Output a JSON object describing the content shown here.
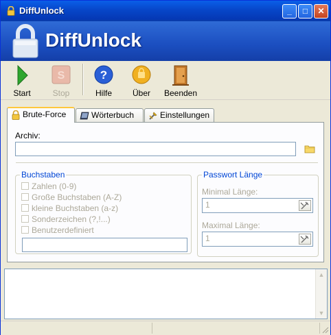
{
  "window": {
    "title": "DiffUnlock",
    "minimize": "_",
    "maximize": "□",
    "close": "✕"
  },
  "banner": {
    "app_name": "DiffUnlock",
    "lock_color": "#dfe8f4",
    "accent": "#1b4ec0"
  },
  "toolbar": {
    "start": "Start",
    "stop": "Stop",
    "help": "Hilfe",
    "about": "Über",
    "exit": "Beenden"
  },
  "tabs": [
    {
      "label": "Brute-Force",
      "icon": "lock-icon",
      "active": true
    },
    {
      "label": "Wörterbuch",
      "icon": "book-icon",
      "active": false
    },
    {
      "label": "Einstellungen",
      "icon": "settings-icon",
      "active": false
    }
  ],
  "bruteforce": {
    "archive_label": "Archiv:",
    "archive_value": "",
    "letters_group": "Buchstaben",
    "options": [
      "Zahlen (0-9)",
      "Große Buchstaben (A-Z)",
      "kleine Buchstaben (a-z)",
      "Sonderzeichen (?,!...)",
      "Benutzerdefiniert"
    ],
    "custom_value": "",
    "pw_group": "Passwort Länge",
    "min_label": "Minimal Länge:",
    "min_value": "1",
    "max_label": "Maximal Länge:",
    "max_value": "1"
  },
  "log": {
    "text": ""
  }
}
